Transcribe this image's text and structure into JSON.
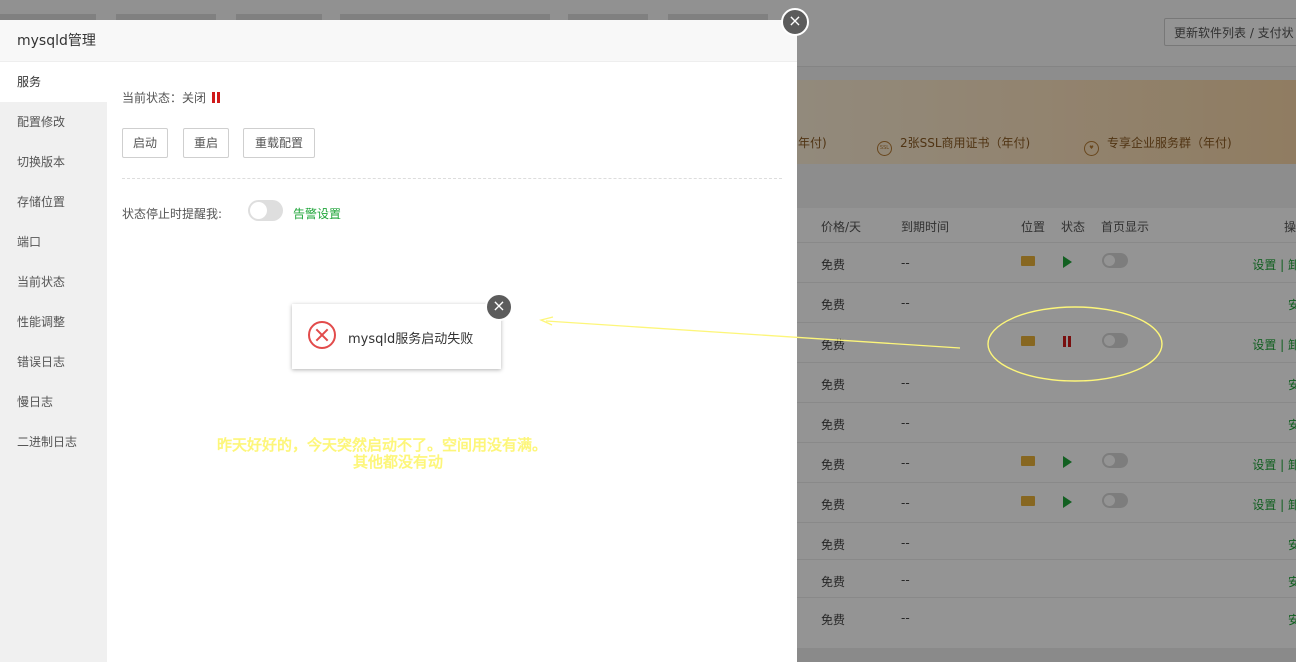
{
  "background_page": {
    "update_button": "更新软件列表 / 支付状",
    "banner_items": [
      "年付)",
      "2张SSL商用证书（年付)",
      "专享企业服务群（年付)"
    ],
    "banner_icons": [
      "ssl-icon",
      "heart-icon"
    ],
    "table_headers": [
      "价格/天",
      "到期时间",
      "位置",
      "状态",
      "首页显示",
      "操"
    ],
    "rows": [
      {
        "price": "免费",
        "expire": "--",
        "folder": true,
        "status": "running",
        "toggle": true,
        "action": "设置 | 卸"
      },
      {
        "price": "免费",
        "expire": "--",
        "folder": false,
        "status": "",
        "toggle": false,
        "action": "安"
      },
      {
        "price": "免费",
        "expire": "",
        "folder": true,
        "status": "stopped",
        "toggle": true,
        "action": "设置 | 卸"
      },
      {
        "price": "免费",
        "expire": "--",
        "folder": false,
        "status": "",
        "toggle": false,
        "action": "安"
      },
      {
        "price": "免费",
        "expire": "--",
        "folder": false,
        "status": "",
        "toggle": false,
        "action": "安"
      },
      {
        "price": "免费",
        "expire": "--",
        "folder": true,
        "status": "running",
        "toggle": true,
        "action": "设置 | 卸"
      },
      {
        "price": "免费",
        "expire": "--",
        "folder": true,
        "status": "running",
        "toggle": true,
        "action": "设置 | 卸"
      },
      {
        "price": "免费",
        "expire": "--",
        "folder": false,
        "status": "",
        "toggle": false,
        "action": "安"
      },
      {
        "price": "免费",
        "expire": "--",
        "folder": false,
        "status": "",
        "toggle": false,
        "action": "安"
      },
      {
        "price": "免费",
        "expire": "--",
        "folder": false,
        "status": "",
        "toggle": false,
        "action": "安"
      }
    ]
  },
  "dialog": {
    "title": "mysqld管理",
    "close_icon": "×",
    "sidebar": [
      {
        "label": "服务",
        "active": true
      },
      {
        "label": "配置修改"
      },
      {
        "label": "切换版本"
      },
      {
        "label": "存储位置"
      },
      {
        "label": "端口"
      },
      {
        "label": "当前状态"
      },
      {
        "label": "性能调整"
      },
      {
        "label": "错误日志"
      },
      {
        "label": "慢日志"
      },
      {
        "label": "二进制日志"
      }
    ],
    "status_label": "当前状态：关闭",
    "buttons": {
      "start": "启动",
      "restart": "重启",
      "reload": "重载配置"
    },
    "alert_label": "状态停止时提醒我:",
    "alert_link": "告警设置"
  },
  "toast": {
    "message": "mysqld服务启动失败",
    "close_icon": "×"
  },
  "annotation": {
    "line1": "昨天好好的，今天突然启动不了。空间用没有满。",
    "line2": "其他都没有动",
    "color": "#fdf67a"
  }
}
